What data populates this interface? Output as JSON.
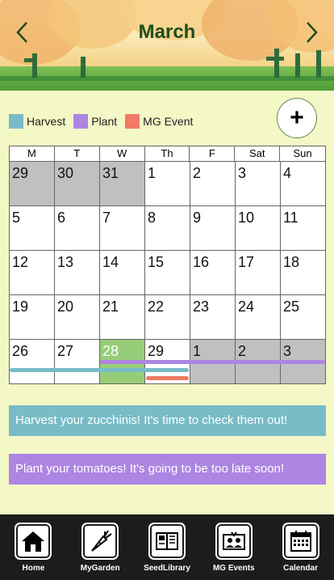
{
  "header": {
    "month": "March"
  },
  "legend": [
    {
      "label": "Harvest",
      "color": "#78bcc7"
    },
    {
      "label": "Plant",
      "color": "#ad85e2"
    },
    {
      "label": "MG Event",
      "color": "#f07a66"
    }
  ],
  "calendar": {
    "weekdays": [
      "M",
      "T",
      "W",
      "Th",
      "F",
      "Sat",
      "Sun"
    ],
    "weeks": [
      [
        "29",
        "30",
        "31",
        "1",
        "2",
        "3",
        "4"
      ],
      [
        "5",
        "6",
        "7",
        "8",
        "9",
        "10",
        "11"
      ],
      [
        "12",
        "13",
        "14",
        "15",
        "16",
        "17",
        "18"
      ],
      [
        "19",
        "20",
        "21",
        "22",
        "23",
        "24",
        "25"
      ],
      [
        "26",
        "27",
        "28",
        "29",
        "1",
        "2",
        "3"
      ]
    ]
  },
  "banners": [
    {
      "text": "Harvest your zucchinis! It's time to check them out!",
      "color": "#78bcc7"
    },
    {
      "text": "Plant your tomatoes! It's going to be too late soon!",
      "color": "#ad85e2"
    }
  ],
  "tabs": [
    {
      "label": "Home",
      "icon": "house-icon"
    },
    {
      "label": "MyGarden",
      "icon": "carrot-icon"
    },
    {
      "label": "SeedLibrary",
      "icon": "seed-book-icon"
    },
    {
      "label": "MG Events",
      "icon": "people-icon"
    },
    {
      "label": "Calendar",
      "icon": "calendar-icon"
    }
  ]
}
